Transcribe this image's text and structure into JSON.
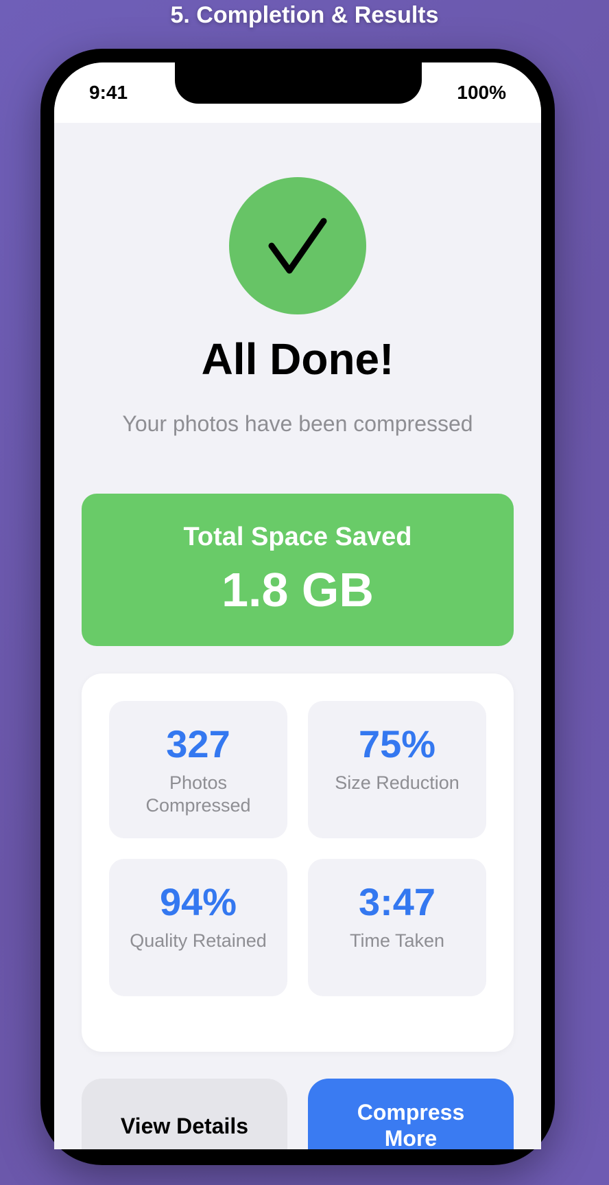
{
  "header": {
    "title": "5. Completion & Results"
  },
  "status_bar": {
    "time": "9:41",
    "battery": "100%"
  },
  "icons": {
    "success": "checkmark-icon"
  },
  "colors": {
    "success": "#67c466",
    "accent": "#3a7bf2",
    "background": "#f2f2f7",
    "secondary_text": "#8e8e93"
  },
  "result": {
    "title": "All Done!",
    "subtitle": "Your photos have been compressed"
  },
  "savings": {
    "label": "Total Space Saved",
    "value": "1.8 GB"
  },
  "stats": [
    {
      "value": "327",
      "label": "Photos Compressed"
    },
    {
      "value": "75%",
      "label": "Size Reduction"
    },
    {
      "value": "94%",
      "label": "Quality Retained"
    },
    {
      "value": "3:47",
      "label": "Time Taken"
    }
  ],
  "actions": {
    "details_label": "View Details",
    "compress_label": "Compress More"
  }
}
